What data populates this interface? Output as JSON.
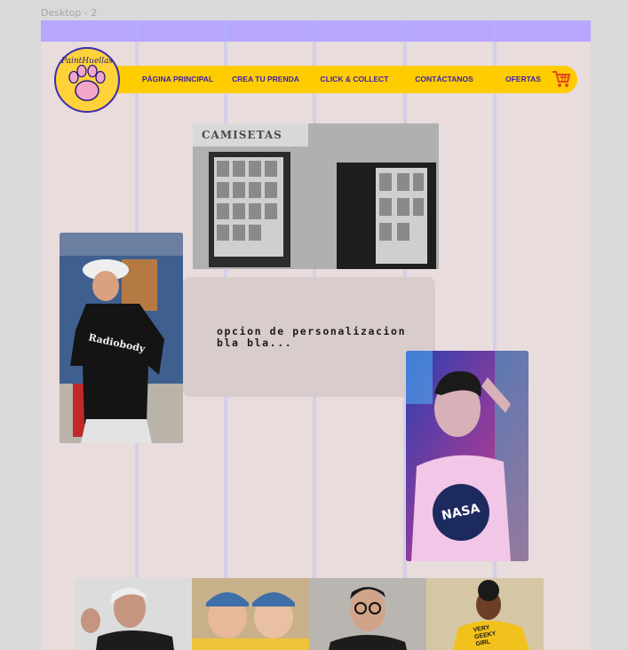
{
  "frame": {
    "label": "Desktop - 2"
  },
  "logo": {
    "text": "PaintHuellas"
  },
  "nav": {
    "items": [
      {
        "label": "PÁGINA PRINCIPAL"
      },
      {
        "label": "CREA TU PRENDA"
      },
      {
        "label": "CLICK & COLLECT"
      },
      {
        "label": "CONTÁCTANOS"
      },
      {
        "label": "OFERTAS"
      }
    ]
  },
  "store_photo": {
    "sign_text": "CAMISETAS"
  },
  "custom_panel": {
    "text": "opcion de personalizacion bla bla..."
  },
  "photo_woman": {
    "shirt_text": "Radiobody"
  },
  "photo_man": {
    "shirt_text": "NASA"
  },
  "bottom_strip": {
    "shirt_text": "VERY GEEKY GIRL"
  },
  "colors": {
    "background": "#e8dcdc",
    "topbar": "#b8a6ff",
    "nav_yellow": "#ffcc00",
    "nav_text": "#3a1fb0",
    "panel": "#d8cccc"
  },
  "icons": [
    "paw-icon",
    "cart-icon"
  ]
}
